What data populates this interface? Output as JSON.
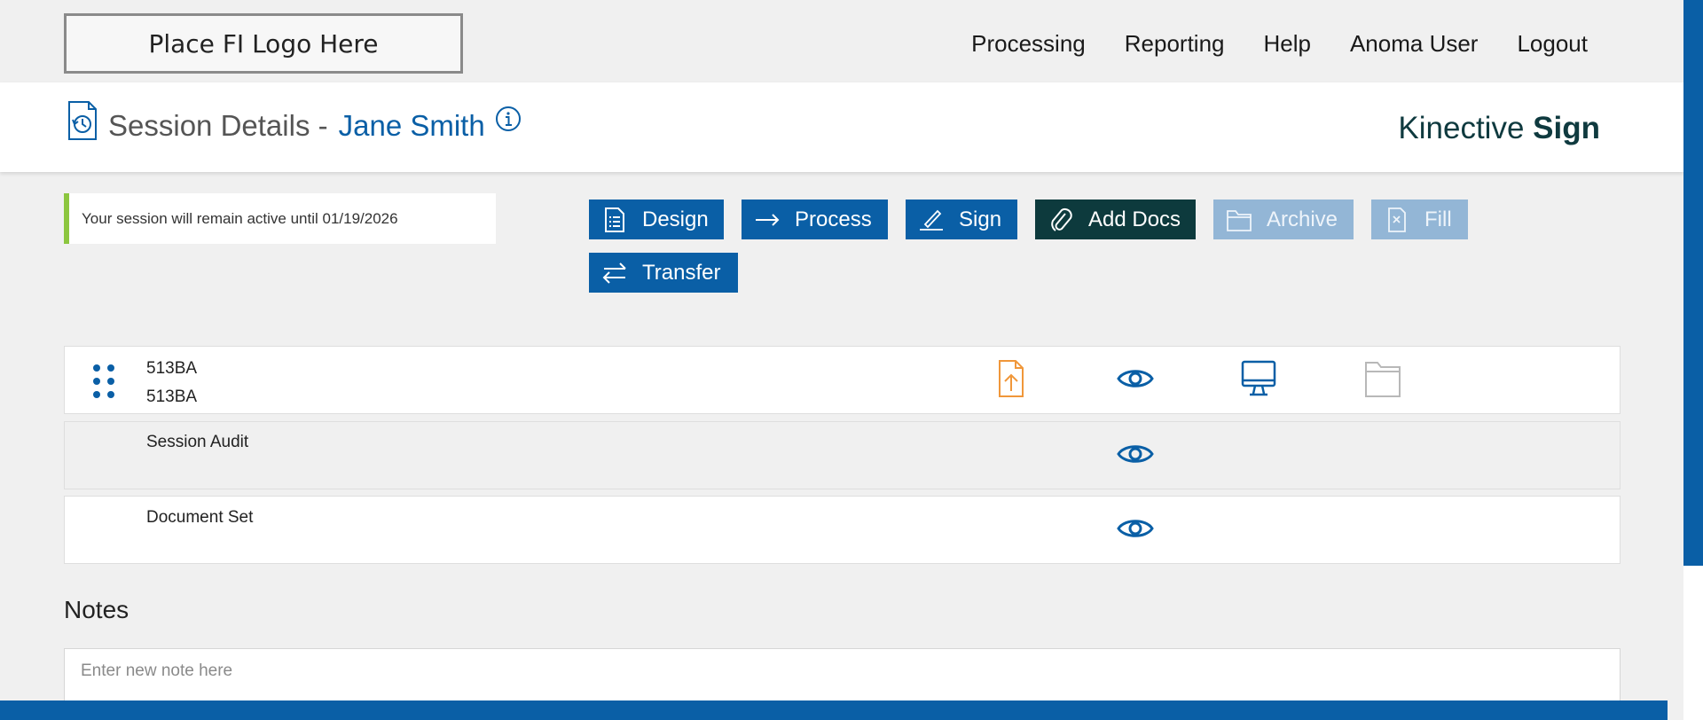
{
  "logo": {
    "text": "Place FI Logo Here"
  },
  "nav": {
    "items": [
      "Processing",
      "Reporting",
      "Help",
      "Anoma User",
      "Logout"
    ]
  },
  "header": {
    "title_prefix": "Session Details -",
    "customer_name": "Jane Smith",
    "brand_regular": "Kinective",
    "brand_bold": "Sign"
  },
  "session_banner": {
    "text": "Your session will remain active until 01/19/2026"
  },
  "actions": {
    "design": "Design",
    "process": "Process",
    "sign": "Sign",
    "add_docs": "Add Docs",
    "archive": "Archive",
    "fill": "Fill",
    "transfer": "Transfer"
  },
  "documents": [
    {
      "line1": "513BA",
      "line2": "513BA",
      "icons": [
        "upload-file-icon",
        "eye-icon",
        "monitor-icon",
        "folder-icon"
      ]
    },
    {
      "line1": "Session Audit",
      "icons": [
        "eye-icon"
      ]
    },
    {
      "line1": "Document Set",
      "icons": [
        "eye-icon"
      ]
    }
  ],
  "notes": {
    "title": "Notes",
    "placeholder": "Enter new note here"
  },
  "colors": {
    "primary": "#0a5fa6",
    "dark": "#0d3a3d",
    "disabled": "#93b6d6",
    "accent_green": "#8cc63f",
    "upload_orange": "#f0973a"
  }
}
